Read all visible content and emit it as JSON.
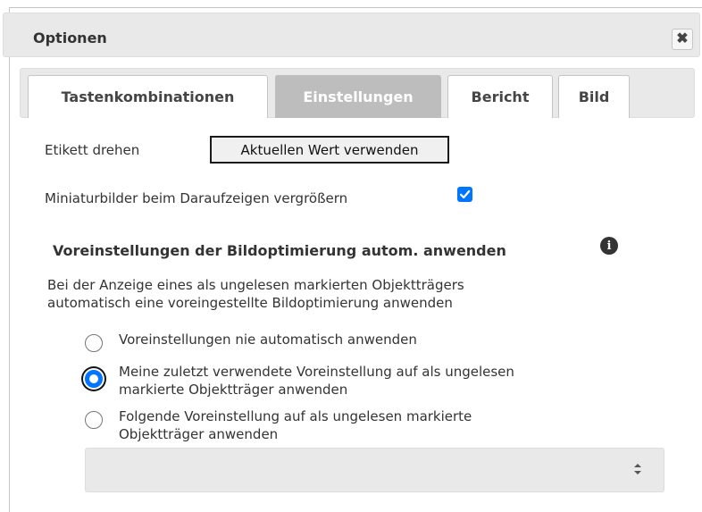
{
  "dialog": {
    "title": "Optionen",
    "close_icon": "close-x-icon"
  },
  "tabs": [
    {
      "label": "Tastenkombinationen",
      "active": false
    },
    {
      "label": "Einstellungen",
      "active": true
    },
    {
      "label": "Bericht",
      "active": false
    },
    {
      "label": "Bild",
      "active": false
    }
  ],
  "settings": {
    "rotate_label": "Etikett drehen",
    "rotate_button": "Aktuellen Wert verwenden",
    "enlarge_label": "Miniaturbilder beim Daraufzeigen vergrößern",
    "enlarge_checked": true,
    "preset_section": {
      "title": "Voreinstellungen der Bildoptimierung autom. anwenden",
      "info_icon": "info-circle-icon",
      "description_line1": "Bei der Anzeige eines als ungelesen markierten Objektträgers",
      "description_line2": "automatisch eine voreingestellte Bildoptimierung anwenden",
      "options": [
        {
          "line1": "Voreinstellungen nie automatisch anwenden",
          "line2": "",
          "selected": false
        },
        {
          "line1": "Meine zuletzt verwendete Voreinstellung auf als ungelesen",
          "line2": "markierte Objektträger anwenden",
          "selected": true
        },
        {
          "line1": "Folgende Voreinstellung auf als ungelesen markierte",
          "line2": "Objektträger anwenden",
          "selected": false
        }
      ],
      "preset_select_value": "",
      "select_arrow_icon": "sort-updown-icon"
    }
  },
  "colors": {
    "accent": "#0075ff",
    "active_tab_bg": "#bdbdbd",
    "header_bg": "#e9e9e9"
  }
}
